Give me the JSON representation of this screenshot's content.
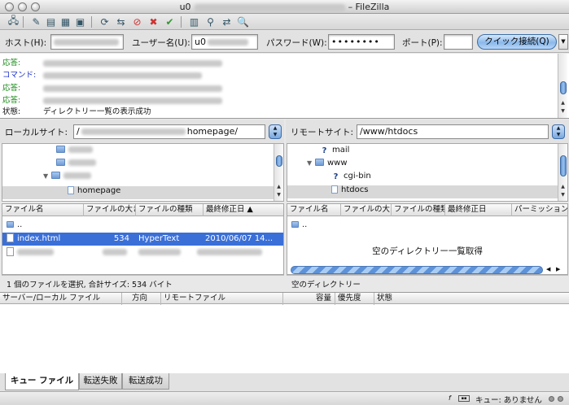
{
  "window": {
    "title_prefix": "u0",
    "title_suffix": "– FileZilla"
  },
  "toolbar": {
    "icons": [
      "site-manager-icon",
      "edit-icon",
      "toggle-log-icon",
      "toggle-tree-icon",
      "toggle-queue-icon",
      "refresh-icon",
      "process-queue-icon",
      "cancel-icon",
      "disconnect-icon",
      "reconnect-icon",
      "filter-icon",
      "compare-icon",
      "sync-icon",
      "search-icon"
    ]
  },
  "quickconnect": {
    "host_label": "ホスト(H):",
    "user_label": "ユーザー名(U):",
    "user_value": "u0",
    "pass_label": "パスワード(W):",
    "pass_value": "••••••••",
    "port_label": "ポート(P):",
    "port_value": "",
    "connect_label": "クイック接続(Q)"
  },
  "log": [
    {
      "kind": "応答:",
      "color": "green"
    },
    {
      "kind": "コマンド:",
      "color": "blue"
    },
    {
      "kind": "応答:",
      "color": "green"
    },
    {
      "kind": "応答:",
      "color": "green"
    },
    {
      "kind": "状態:",
      "color": "black",
      "text": "ディレクトリー一覧の表示成功"
    }
  ],
  "local": {
    "site_label": "ローカルサイト:",
    "path_start": "/",
    "path_end": "homepage/",
    "tree_items": [
      {
        "label": "homepage"
      }
    ],
    "columns": [
      "ファイル名",
      "ファイルの大き",
      "ファイルの種類",
      "最終修正日"
    ],
    "up_label": "..",
    "files": [
      {
        "name": "index.html",
        "size": "534",
        "type": "HyperText",
        "date": "2010/06/07 14..."
      }
    ],
    "status": "1 個のファイルを選択, 合計サイズ: 534 バイト"
  },
  "remote": {
    "site_label": "リモートサイト:",
    "path": "/www/htdocs",
    "tree_items": [
      {
        "label": "mail",
        "icon": "question"
      },
      {
        "label": "www",
        "icon": "folder"
      },
      {
        "label": "cgi-bin",
        "icon": "question"
      },
      {
        "label": "htdocs",
        "icon": "folder"
      }
    ],
    "columns": [
      "ファイル名",
      "ファイルの大き",
      "ファイルの種類",
      "最終修正日",
      "パーミッション"
    ],
    "up_label": "..",
    "loading_text": "空のディレクトリー一覧取得",
    "status": "空のディレクトリー"
  },
  "queue": {
    "columns": [
      "サーバー/ローカル ファイル",
      "方向",
      "リモートファイル",
      "容量",
      "優先度",
      "状態"
    ],
    "tabs": [
      "キュー ファイル",
      "転送失敗",
      "転送成功"
    ]
  },
  "statusbar": {
    "queue_text": "キュー: ありません"
  }
}
